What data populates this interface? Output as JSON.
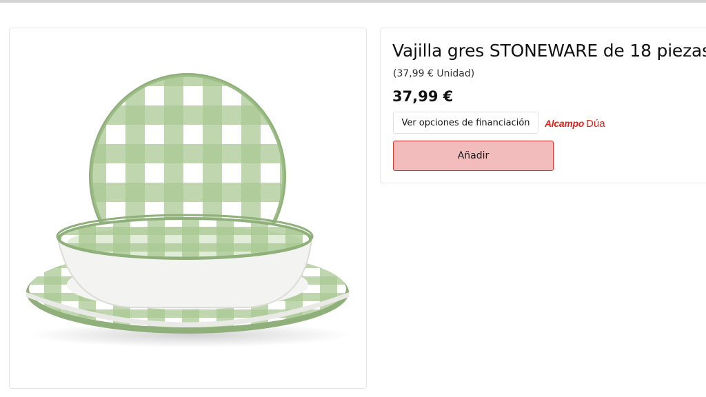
{
  "product": {
    "title": "Vajilla gres STONEWARE de 18 piezas.",
    "unit_price": "(37,99 € Unidad)",
    "price": "37,99 €",
    "image_icon": "checkered-dinnerware-image"
  },
  "actions": {
    "financing_label": "Ver opciones de financiación",
    "add_label": "Añadir"
  },
  "brand": {
    "name": "Alcampo",
    "sub": "Dúa",
    "color": "#e2231a"
  },
  "colors": {
    "accent": "#e2231a",
    "add_button_bg": "#f2bcbc",
    "add_button_border": "#d9342b",
    "plate_green": "#a5c48e"
  }
}
